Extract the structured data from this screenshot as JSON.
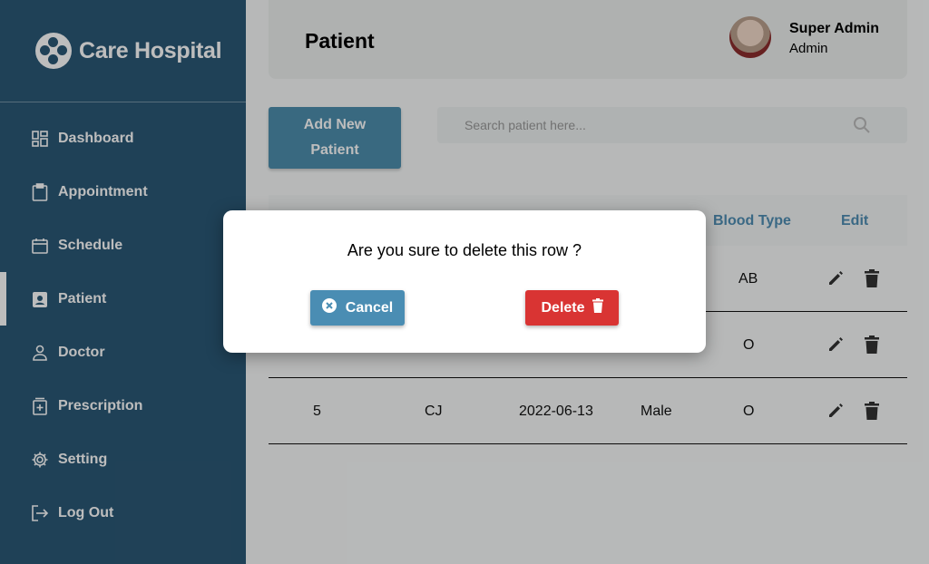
{
  "brand": {
    "name": "Care Hospital"
  },
  "sidebar": {
    "items": [
      {
        "label": "Dashboard",
        "icon": "dashboard-icon"
      },
      {
        "label": "Appointment",
        "icon": "clipboard-icon"
      },
      {
        "label": "Schedule",
        "icon": "calendar-icon"
      },
      {
        "label": "Patient",
        "icon": "patient-badge-icon",
        "active": true
      },
      {
        "label": "Doctor",
        "icon": "person-icon"
      },
      {
        "label": "Prescription",
        "icon": "prescription-icon"
      },
      {
        "label": "Setting",
        "icon": "gear-icon"
      },
      {
        "label": "Log Out",
        "icon": "logout-icon"
      }
    ]
  },
  "header": {
    "title": "Patient",
    "user_name": "Super Admin",
    "user_role": "Admin"
  },
  "toolbar": {
    "add_label_line1": "Add New",
    "add_label_line2": "Patient",
    "search_placeholder": "Search patient here..."
  },
  "table": {
    "visible_headers": [
      "Blood Type",
      "Edit"
    ],
    "rows": [
      {
        "id": "",
        "name": "",
        "date": "",
        "gender": "",
        "blood": "AB"
      },
      {
        "id": "",
        "name": "",
        "date": "",
        "gender": "",
        "blood": "O"
      },
      {
        "id": "5",
        "name": "CJ",
        "date": "2022-06-13",
        "gender": "Male",
        "blood": "O"
      }
    ]
  },
  "modal": {
    "message": "Are you sure to delete this row ?",
    "cancel_label": "Cancel",
    "delete_label": "Delete"
  },
  "colors": {
    "sidebar": "#2b5876",
    "accent": "#4a8db3",
    "danger": "#d93433"
  }
}
